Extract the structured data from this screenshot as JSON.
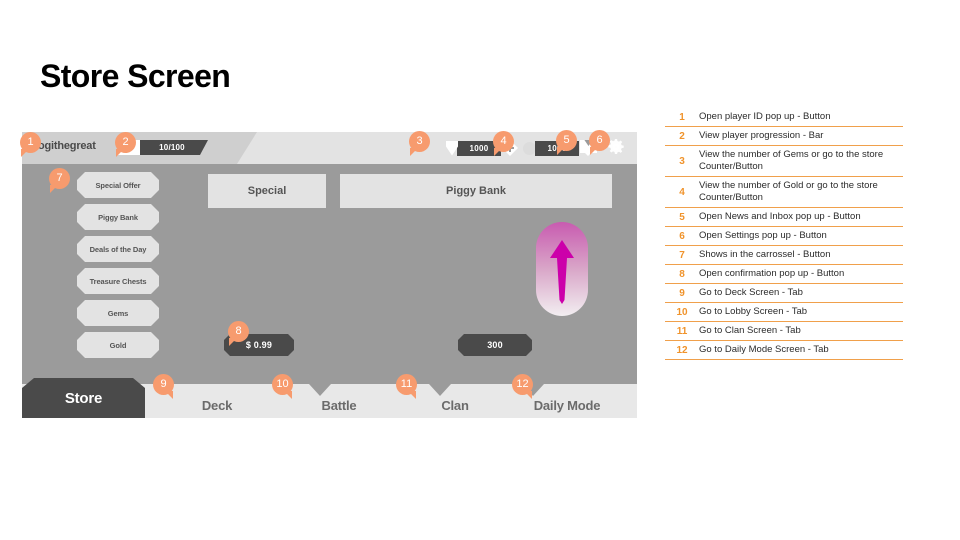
{
  "page": {
    "title": "Store Screen"
  },
  "colors": {
    "badge": "#f79b6e",
    "legend_accent": "#f0932b",
    "legend_rule": "#f0a04b",
    "panel_bg": "#9b9b9b",
    "panel_header": "#e3e3e3",
    "dark": "#4a4a4a",
    "arrow": "#cc00aa"
  },
  "mockup": {
    "topbar": {
      "username": "ogithegreat",
      "progression": {
        "value": "10/100",
        "icon": "progression-icon"
      },
      "currencies": [
        {
          "name": "gems",
          "icon": "gem-icon",
          "amount": "1000",
          "plus": "+"
        },
        {
          "name": "gold",
          "icon": "coin-icon",
          "amount": "1000",
          "plus": "+"
        }
      ],
      "mail_icon": "mail-icon",
      "settings_icon": "gear-icon"
    },
    "sidebar": {
      "items": [
        {
          "label": "Special Offer"
        },
        {
          "label": "Piggy Bank"
        },
        {
          "label": "Deals of the Day"
        },
        {
          "label": "Treasure Chests"
        },
        {
          "label": "Gems"
        },
        {
          "label": "Gold"
        }
      ]
    },
    "panels": [
      {
        "title": "Special",
        "price": "$ 0.99"
      },
      {
        "title": "Piggy Bank",
        "price": "300",
        "art_icon": "up-arrow-icon"
      }
    ],
    "tabs": [
      {
        "label": "Store",
        "active": true
      },
      {
        "label": "Deck",
        "active": false
      },
      {
        "label": "Battle",
        "active": false
      },
      {
        "label": "Clan",
        "active": false
      },
      {
        "label": "Daily Mode",
        "active": false
      }
    ]
  },
  "badges": [
    {
      "n": "1"
    },
    {
      "n": "2"
    },
    {
      "n": "3"
    },
    {
      "n": "4"
    },
    {
      "n": "5"
    },
    {
      "n": "6"
    },
    {
      "n": "7"
    },
    {
      "n": "8"
    },
    {
      "n": "9"
    },
    {
      "n": "10"
    },
    {
      "n": "11"
    },
    {
      "n": "12"
    }
  ],
  "legend": {
    "rows": [
      {
        "num": "1",
        "text": "Open player ID pop up - Button"
      },
      {
        "num": "2",
        "text": "View player progression - Bar"
      },
      {
        "num": "3",
        "text": "View the number of Gems or go to the store Counter/Button"
      },
      {
        "num": "4",
        "text": "View the number of Gold or go to the store Counter/Button"
      },
      {
        "num": "5",
        "text": "Open News and Inbox pop up - Button"
      },
      {
        "num": "6",
        "text": "Open Settings pop up - Button"
      },
      {
        "num": "7",
        "text": "Shows in the carrossel - Button"
      },
      {
        "num": "8",
        "text": "Open confirmation pop up - Button"
      },
      {
        "num": "9",
        "text": "Go to Deck Screen - Tab"
      },
      {
        "num": "10",
        "text": "Go to Lobby Screen - Tab"
      },
      {
        "num": "11",
        "text": "Go to Clan Screen - Tab"
      },
      {
        "num": "12",
        "text": "Go to Daily Mode Screen - Tab"
      }
    ]
  }
}
